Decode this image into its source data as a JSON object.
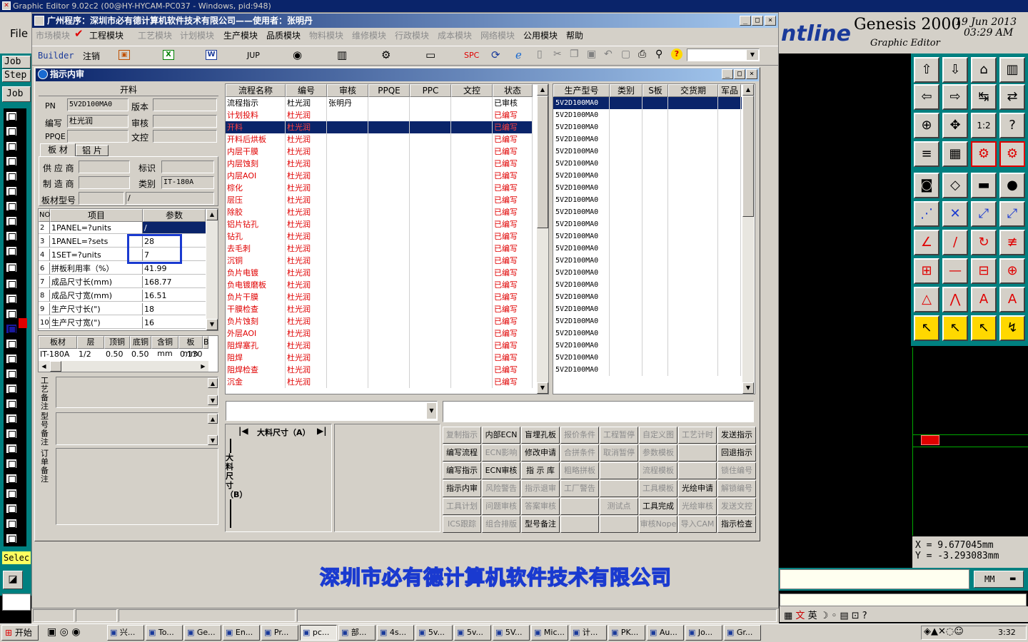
{
  "titlebar": {
    "text": "Graphic Editor 9.02c2 (00@HY-HYCAM-PC037 - Windows, pid:948)"
  },
  "genesis": {
    "file_label": "File",
    "brand": "ntline",
    "product": "Genesis 2000",
    "subtitle": "Graphic Editor",
    "date": "19 Jun 2013",
    "time": "03:29 AM",
    "job_label": "Job",
    "step_label": "Step",
    "job_button": "Job",
    "select_label": "Selec",
    "coord_x": "X  =  9.677045mm",
    "coord_y": "Y  = -3.293083mm",
    "unit": "MM"
  },
  "app": {
    "title": "广州程序：深圳市必有德计算机软件技术有限公司——使用者：张明丹",
    "menu": [
      "市场模块",
      "工程模块",
      "工艺模块",
      "计划模块",
      "生产模块",
      "品质模块",
      "物料模块",
      "维修模块",
      "行政模块",
      "成本模块",
      "网络模块",
      "公用模块",
      "帮助"
    ],
    "toolbar": {
      "builder": "Builder",
      "logout": "注销",
      "jup": "JUP",
      "spc": "SPC"
    },
    "footer_company": "深圳市必有德计算机软件技术有限公司"
  },
  "sub": {
    "title": "指示内审",
    "open_label": "开料",
    "fields": {
      "pn_label": "PN",
      "pn_value": "5V2D100MA0",
      "version_label": "版本",
      "author_label": "编写",
      "author_value": "杜光润",
      "review_label": "审核",
      "ppqe_label": "PPQE",
      "doc_label": "文控"
    },
    "tabs": [
      "板 材",
      "铝 片"
    ],
    "board": {
      "supplier_label": "供 应 商",
      "mark_label": "标识",
      "maker_label": "制 造 商",
      "type_label": "类别",
      "type_value": "IT-180A",
      "model_label": "板材型号",
      "model_value": "/"
    },
    "param_table": {
      "headers": [
        "NO",
        "项目",
        "参数"
      ],
      "rows": [
        [
          "2",
          "1PANEL=?units",
          "/"
        ],
        [
          "3",
          "1PANEL=?sets",
          "28"
        ],
        [
          "4",
          "1SET=?units",
          "7"
        ],
        [
          "6",
          "拼板利用率（%）",
          "41.99"
        ],
        [
          "7",
          "成品尺寸长(mm)",
          "168.77"
        ],
        [
          "8",
          "成品尺寸宽(mm)",
          "16.51"
        ],
        [
          "9",
          "生产尺寸长(\")",
          "18"
        ],
        [
          "10",
          "生产尺寸宽(\")",
          "16"
        ]
      ]
    },
    "material_table": {
      "headers": [
        "板材",
        "层",
        "顶铜",
        "底铜",
        "含铜mm",
        "板mm",
        "B"
      ],
      "row": [
        "IT-180A",
        "1/2",
        "0.50",
        "0.50",
        "",
        "0.130",
        ""
      ]
    },
    "notes": {
      "process": "工艺备注",
      "model": "型号备注",
      "order": "订单备注"
    },
    "process_table": {
      "headers": [
        "流程名称",
        "编号",
        "审核",
        "PPQE",
        "PPC",
        "文控",
        "状态"
      ],
      "rows": [
        [
          "流程指示",
          "杜光润",
          "张明丹",
          "已审核"
        ],
        [
          "计划投料",
          "杜光润",
          "",
          "已编写"
        ],
        [
          "开料",
          "杜光润",
          "",
          "已编写"
        ],
        [
          "开料后烘板",
          "杜光润",
          "",
          "已编写"
        ],
        [
          "内层干膜",
          "杜光润",
          "",
          "已编写"
        ],
        [
          "内层蚀刻",
          "杜光润",
          "",
          "已编写"
        ],
        [
          "内层AOI",
          "杜光润",
          "",
          "已编写"
        ],
        [
          "棕化",
          "杜光润",
          "",
          "已编写"
        ],
        [
          "层压",
          "杜光润",
          "",
          "已编写"
        ],
        [
          "除胶",
          "杜光润",
          "",
          "已编写"
        ],
        [
          "铝片钻孔",
          "杜光润",
          "",
          "已编写"
        ],
        [
          "钻孔",
          "杜光润",
          "",
          "已编写"
        ],
        [
          "去毛刺",
          "杜光润",
          "",
          "已编写"
        ],
        [
          "沉铜",
          "杜光润",
          "",
          "已编写"
        ],
        [
          "负片电镀",
          "杜光润",
          "",
          "已编写"
        ],
        [
          "负电镀磨板",
          "杜光润",
          "",
          "已编写"
        ],
        [
          "负片干膜",
          "杜光润",
          "",
          "已编写"
        ],
        [
          "干膜检查",
          "杜光润",
          "",
          "已编写"
        ],
        [
          "负片蚀刻",
          "杜光润",
          "",
          "已编写"
        ],
        [
          "外层AOI",
          "杜光润",
          "",
          "已编写"
        ],
        [
          "阻焊塞孔",
          "杜光润",
          "",
          "已编写"
        ],
        [
          "阻焊",
          "杜光润",
          "",
          "已编写"
        ],
        [
          "阻焊检查",
          "杜光润",
          "",
          "已编写"
        ],
        [
          "沉金",
          "杜光润",
          "",
          "已编写"
        ]
      ]
    },
    "model_table": {
      "headers": [
        "生产型号",
        "类别",
        "S板",
        "交货期",
        "军品"
      ],
      "rows": [
        "5V2D100MA0",
        "5V2D100MA0",
        "5V2D100MA0",
        "5V2D100MA0",
        "5V2D100MA0",
        "5V2D100MA0",
        "5V2D100MA0",
        "5V2D100MA0",
        "5V2D100MA0",
        "5V2D100MA0",
        "5V2D100MA0",
        "5V2D100MA0",
        "5V2D100MA0",
        "5V2D100MA0",
        "5V2D100MA0",
        "5V2D100MA0",
        "5V2D100MA0",
        "5V2D100MA0",
        "5V2D100MA0",
        "5V2D100MA0",
        "5V2D100MA0",
        "5V2D100MA0",
        "5V2D100MA0"
      ]
    },
    "dims": {
      "a": "大料尺寸（A）",
      "b": "大料尺寸（B）"
    },
    "buttons": [
      [
        "复制指示",
        "内部ECN",
        "盲埋孔板",
        "报价条件",
        "工程暂停",
        "自定义图",
        "工艺计时",
        "发送指示"
      ],
      [
        "编写流程",
        "ECN影响",
        "修改申请",
        "合拼条件",
        "取消暂停",
        "参数模板",
        "",
        "回退指示"
      ],
      [
        "编写指示",
        "ECN审核",
        "指 示 库",
        "粗略拼板",
        "",
        "流程模板",
        "",
        "锁住编号"
      ],
      [
        "指示内审",
        "风险警告",
        "指示退审",
        "工厂警告",
        "",
        "工具模板",
        "光绘申请",
        "解锁编号"
      ],
      [
        "工具计划",
        "问题审核",
        "答案审核",
        "",
        "测试点",
        "工具完成",
        "光绘审核",
        "发送文控"
      ],
      [
        "ICS跟踪",
        "组合排版",
        "型号备注",
        "",
        "",
        "审核Nope",
        "导入CAM",
        "指示检查"
      ]
    ],
    "buttons_enabled": [
      [
        false,
        true,
        true,
        false,
        false,
        false,
        false,
        true
      ],
      [
        true,
        false,
        true,
        false,
        false,
        false,
        false,
        true
      ],
      [
        true,
        true,
        true,
        false,
        false,
        false,
        false,
        false
      ],
      [
        true,
        false,
        false,
        false,
        false,
        false,
        true,
        false
      ],
      [
        false,
        false,
        false,
        false,
        false,
        true,
        false,
        false
      ],
      [
        false,
        false,
        true,
        false,
        false,
        false,
        false,
        true
      ]
    ]
  },
  "ime": {
    "lang": "英"
  },
  "taskbar": {
    "start": "开始",
    "items": [
      "兴...",
      "To...",
      "Ge...",
      "En...",
      "Pr...",
      "pc...",
      "部...",
      "4s...",
      "5v...",
      "5v...",
      "5V...",
      "Mic...",
      "计...",
      "PK...",
      "Au...",
      "Jo...",
      "Gr..."
    ],
    "clock": "3:32"
  },
  "colors": {
    "title_blue": "#0a246a",
    "red_text": "#e00000",
    "face": "#d4d0c8",
    "teal": "#008080"
  }
}
